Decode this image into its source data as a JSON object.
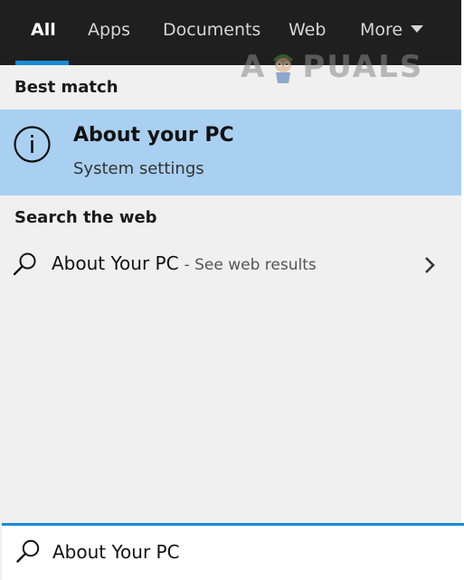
{
  "tabs": [
    {
      "label": "All",
      "active": true
    },
    {
      "label": "Apps",
      "active": false
    },
    {
      "label": "Documents",
      "active": false
    },
    {
      "label": "Web",
      "active": false
    },
    {
      "label": "More",
      "active": false
    }
  ],
  "watermark": {
    "text_before": "A",
    "text_after": "PUALS"
  },
  "best_match": {
    "section_title": "Best match",
    "title": "About your PC",
    "subtitle": "System settings",
    "icon": "info-icon"
  },
  "web": {
    "section_title": "Search the web",
    "query": "About Your PC",
    "suffix": "- See web results",
    "icon": "search-icon",
    "chevron_icon": "chevron-right-icon"
  },
  "search": {
    "value": "About Your PC",
    "icon": "search-icon"
  },
  "colors": {
    "accent": "#1a8ad4",
    "highlight": "#a9d0f0",
    "tabbar": "#1f1f1f",
    "panel": "#f0f0f0"
  }
}
